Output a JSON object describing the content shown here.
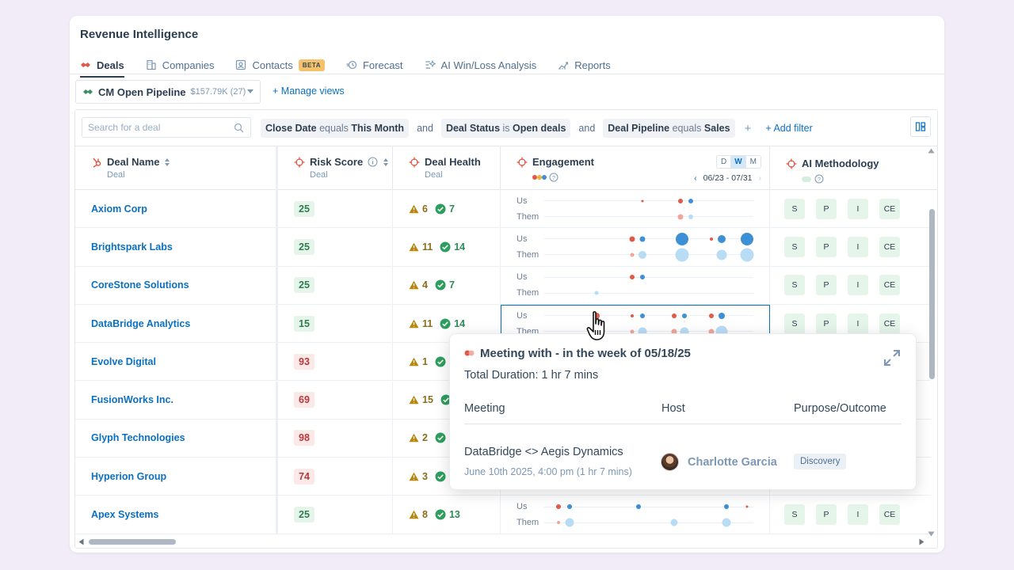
{
  "app_title": "Revenue Intelligence",
  "tabs": [
    {
      "label": "Deals",
      "icon": "handshake-icon",
      "active": true
    },
    {
      "label": "Companies",
      "icon": "building-icon"
    },
    {
      "label": "Contacts",
      "icon": "contact-card-icon",
      "badge": "BETA"
    },
    {
      "label": "Forecast",
      "icon": "forecast-icon"
    },
    {
      "label": "AI Win/Loss Analysis",
      "icon": "ai-analysis-icon"
    },
    {
      "label": "Reports",
      "icon": "reports-icon"
    }
  ],
  "view": {
    "name": "CM Open Pipeline",
    "meta": "$157.79K (27)"
  },
  "manage_views": "Manage views",
  "search": {
    "placeholder": "Search for a deal"
  },
  "filters": [
    {
      "field": "Close Date",
      "op": "equals",
      "value": "This Month"
    },
    {
      "join": "and"
    },
    {
      "field": "Deal Status",
      "op": "is",
      "value": "Open deals"
    },
    {
      "join": "and"
    },
    {
      "field": "Deal Pipeline",
      "op": "equals",
      "value": "Sales"
    }
  ],
  "add_filter": "Add filter",
  "columns": {
    "deal_name": {
      "label": "Deal Name",
      "sub": "Deal"
    },
    "risk_score": {
      "label": "Risk Score",
      "sub": "Deal"
    },
    "deal_health": {
      "label": "Deal Health",
      "sub": "Deal"
    },
    "engagement": {
      "label": "Engagement",
      "range": "06/23 - 07/31",
      "toggle": [
        "D",
        "W",
        "M"
      ],
      "active_toggle": "W"
    },
    "ai_methodology": {
      "label": "AI Methodology"
    }
  },
  "eng_labels": {
    "us": "Us",
    "them": "Them"
  },
  "rows": [
    {
      "name": "Axiom Corp",
      "risk": "25",
      "risk_level": "low",
      "warn": "6",
      "ok": "7",
      "meth": [
        "S",
        "P",
        "I",
        "CE"
      ]
    },
    {
      "name": "Brightspark Labs",
      "risk": "25",
      "risk_level": "low",
      "warn": "11",
      "ok": "14",
      "meth": [
        "S",
        "P",
        "I",
        "CE"
      ]
    },
    {
      "name": "CoreStone Solutions",
      "risk": "25",
      "risk_level": "low",
      "warn": "4",
      "ok": "7",
      "meth": [
        "S",
        "P",
        "I",
        "CE"
      ]
    },
    {
      "name": "DataBridge Analytics",
      "risk": "15",
      "risk_level": "low",
      "warn": "11",
      "ok": "14",
      "meth": [
        "S",
        "P",
        "I",
        "CE"
      ]
    },
    {
      "name": "Evolve Digital",
      "risk": "93",
      "risk_level": "high",
      "warn": "1",
      "ok": "",
      "meth": []
    },
    {
      "name": "FusionWorks Inc.",
      "risk": "69",
      "risk_level": "high",
      "warn": "15",
      "ok": "",
      "meth": []
    },
    {
      "name": "Glyph Technologies",
      "risk": "98",
      "risk_level": "high",
      "warn": "2",
      "ok": "",
      "meth": []
    },
    {
      "name": "Hyperion Group",
      "risk": "74",
      "risk_level": "high",
      "warn": "3",
      "ok": "",
      "meth": []
    },
    {
      "name": "Apex Systems",
      "risk": "25",
      "risk_level": "low",
      "warn": "8",
      "ok": "13",
      "meth": [
        "S",
        "P",
        "I",
        "CE"
      ]
    }
  ],
  "popup": {
    "title": "Meeting with - in the week of 05/18/25",
    "duration": "Total Duration: 1 hr 7 mins",
    "col_meeting": "Meeting",
    "col_host": "Host",
    "col_purpose": "Purpose/Outcome",
    "meeting_name": "DataBridge <> Aegis Dynamics",
    "meeting_date": "June 10th 2025, 4:00 pm (1 hr 7 mins)",
    "host": "Charlotte Garcia",
    "purpose": "Discovery"
  },
  "colors": {
    "accent": "#0b70c2",
    "us_dot": "#e05a47",
    "them_dot": "#3d8fd6",
    "them_light": "#b9dcf5",
    "us_light": "#f2a59a"
  }
}
